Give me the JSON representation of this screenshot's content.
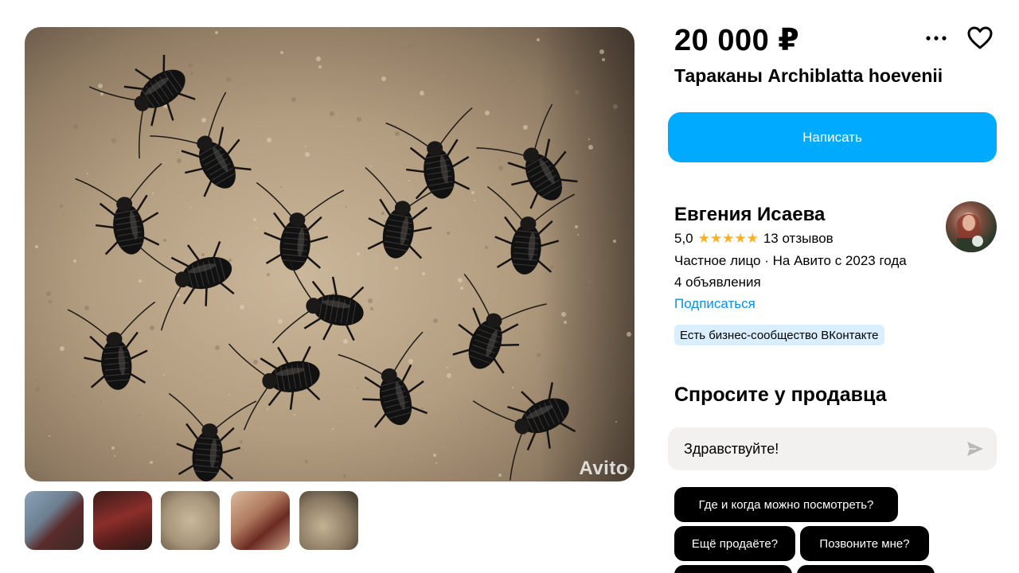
{
  "listing": {
    "price": "20 000 ₽",
    "title": "Тараканы Archiblatta hoevenii",
    "write_label": "Написать",
    "watermark": "Avito"
  },
  "icons": {
    "more": "more-dots-icon",
    "favorite": "heart-icon",
    "send": "send-icon"
  },
  "seller": {
    "name": "Евгения Исаева",
    "rating": "5,0",
    "stars": "★★★★★",
    "reviews": "13 отзывов",
    "type": "Частное лицо · На Авито с 2023 года",
    "ads": "4 объявления",
    "subscribe": "Подписаться",
    "badge": "Есть бизнес-сообщество ВКонтакте"
  },
  "ask": {
    "heading": "Спросите у продавца",
    "message_value": "Здравствуйте!",
    "chips": [
      "Где и когда можно посмотреть?",
      "Ещё продаёте?",
      "Позвоните мне?"
    ]
  },
  "gallery": {
    "thumb_count": 5,
    "active_index": 2
  },
  "colors": {
    "accent": "#00aaff",
    "link": "#0a8ef2",
    "star": "#ffb021",
    "badge_bg": "#d9efff"
  }
}
